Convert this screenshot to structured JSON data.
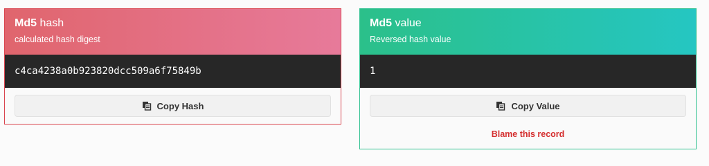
{
  "hash_card": {
    "title_strong": "Md5",
    "title_rest": " hash",
    "subtitle": "calculated hash digest",
    "value": "c4ca4238a0b923820dcc509a6f75849b",
    "button_label": "Copy Hash",
    "button_icon": "copy-icon",
    "accent": "#e0656d"
  },
  "value_card": {
    "title_strong": "Md5",
    "title_rest": " value",
    "subtitle": "Reversed hash value",
    "value": "1",
    "button_label": "Copy Value",
    "button_icon": "copy-icon",
    "link_label": "Blame this record",
    "accent": "#2bc08a"
  }
}
